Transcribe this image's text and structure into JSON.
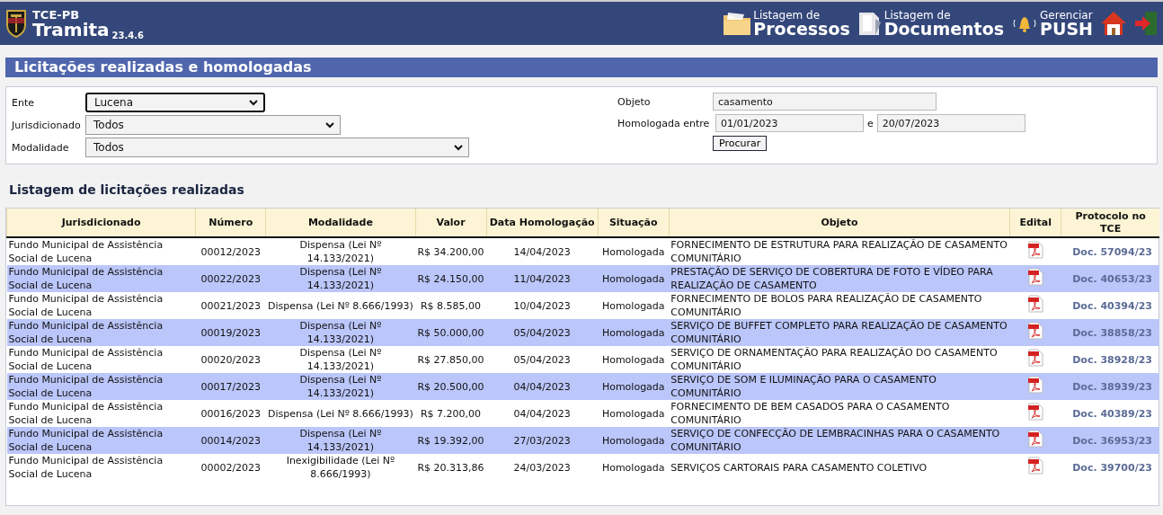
{
  "header": {
    "org": "TCE-PB",
    "app": "Tramita",
    "version": "23.4.6",
    "nav": [
      {
        "kind": "folder",
        "small": "Listagem de",
        "big": "Processos"
      },
      {
        "kind": "document",
        "small": "Listagem de",
        "big": "Documentos"
      },
      {
        "kind": "bell",
        "small": "Gerenciar",
        "big": "PUSH"
      }
    ],
    "actions": [
      {
        "kind": "home"
      },
      {
        "kind": "exit"
      }
    ]
  },
  "page_title": "Licitações realizadas e homologadas",
  "filters": {
    "selects": [
      {
        "label": "Ente",
        "value": "Lucena",
        "focused": true
      },
      {
        "label": "Jurisdicionado",
        "value": "Todos",
        "focused": false
      },
      {
        "label": "Modalidade",
        "value": "Todos",
        "focused": false
      }
    ],
    "objeto": {
      "label": "Objeto",
      "value": "casamento"
    },
    "homologada": {
      "label": "Homologada entre",
      "from": "01/01/2023",
      "joiner": "e",
      "to": "20/07/2023"
    },
    "search_button": "Procurar"
  },
  "section_title": "Listagem de licitações realizadas",
  "table": {
    "columns": [
      "Jurisdicionado",
      "Número",
      "Modalidade",
      "Valor",
      "Data Homologação",
      "Situação",
      "Objeto",
      "Edital",
      "Protocolo no TCE"
    ],
    "rows": [
      {
        "jurisdicionado": "Fundo Municipal de Assistência Social de Lucena",
        "numero": "00012/2023",
        "modalidade": "Dispensa (Lei Nº 14.133/2021)",
        "valor": "R$ 34.200,00",
        "data": "14/04/2023",
        "situacao": "Homologada",
        "objeto": "FORNECIMENTO DE ESTRUTURA PARA REALIZAÇÃO DE CASAMENTO COMUNITÁRIO",
        "protocolo": "Doc. 57094/23"
      },
      {
        "jurisdicionado": "Fundo Municipal de Assistência Social de Lucena",
        "numero": "00022/2023",
        "modalidade": "Dispensa (Lei Nº 14.133/2021)",
        "valor": "R$ 24.150,00",
        "data": "11/04/2023",
        "situacao": "Homologada",
        "objeto": "PRESTAÇÃO DE SERVIÇO DE COBERTURA DE FOTO E VÍDEO PARA REALIZAÇÃO DE CASAMENTO",
        "protocolo": "Doc. 40653/23"
      },
      {
        "jurisdicionado": "Fundo Municipal de Assistência Social de Lucena",
        "numero": "00021/2023",
        "modalidade": "Dispensa (Lei Nº 8.666/1993)",
        "valor": "R$ 8.585,00",
        "data": "10/04/2023",
        "situacao": "Homologada",
        "objeto": "FORNECIMENTO DE BOLOS PARA REALIZAÇÃO DE CASAMENTO COMUNITÁRIO",
        "protocolo": "Doc. 40394/23"
      },
      {
        "jurisdicionado": "Fundo Municipal de Assistência Social de Lucena",
        "numero": "00019/2023",
        "modalidade": "Dispensa (Lei Nº 14.133/2021)",
        "valor": "R$ 50.000,00",
        "data": "05/04/2023",
        "situacao": "Homologada",
        "objeto": "SERVIÇO DE BUFFET COMPLETO PARA REALIZAÇÃO DE CASAMENTO COMUNITÁRIO",
        "protocolo": "Doc. 38858/23"
      },
      {
        "jurisdicionado": "Fundo Municipal de Assistência Social de Lucena",
        "numero": "00020/2023",
        "modalidade": "Dispensa (Lei Nº 14.133/2021)",
        "valor": "R$ 27.850,00",
        "data": "05/04/2023",
        "situacao": "Homologada",
        "objeto": "SERVIÇO DE ORNAMENTAÇÃO PARA REALIZAÇÃO DO CASAMENTO COMUNITÁRIO",
        "protocolo": "Doc. 38928/23"
      },
      {
        "jurisdicionado": "Fundo Municipal de Assistência Social de Lucena",
        "numero": "00017/2023",
        "modalidade": "Dispensa (Lei Nº 14.133/2021)",
        "valor": "R$ 20.500,00",
        "data": "04/04/2023",
        "situacao": "Homologada",
        "objeto": "SERVIÇO DE SOM E ILUMINAÇÃO PARA O CASAMENTO COMUNITÁRIO",
        "protocolo": "Doc. 38939/23"
      },
      {
        "jurisdicionado": "Fundo Municipal de Assistência Social de Lucena",
        "numero": "00016/2023",
        "modalidade": "Dispensa (Lei Nº 8.666/1993)",
        "valor": "R$ 7.200,00",
        "data": "04/04/2023",
        "situacao": "Homologada",
        "objeto": "FORNECIMENTO DE BEM CASADOS PARA O CASAMENTO COMUNITÁRIO",
        "protocolo": "Doc. 40389/23"
      },
      {
        "jurisdicionado": "Fundo Municipal de Assistência Social de Lucena",
        "numero": "00014/2023",
        "modalidade": "Dispensa (Lei Nº 14.133/2021)",
        "valor": "R$ 19.392,00",
        "data": "27/03/2023",
        "situacao": "Homologada",
        "objeto": "SERVIÇO DE CONFECÇÃO DE LEMBRACINHAS PARA O CASAMENTO COMUNITÁRIO",
        "protocolo": "Doc. 36953/23"
      },
      {
        "jurisdicionado": "Fundo Municipal de Assistência Social de Lucena",
        "numero": "00002/2023",
        "modalidade": "Inexigibilidade (Lei Nº 8.666/1993)",
        "valor": "R$ 20.313,86",
        "data": "24/03/2023",
        "situacao": "Homologada",
        "objeto": "SERVIÇOS CARTORAIS PARA CASAMENTO COLETIVO",
        "protocolo": "Doc. 39700/23"
      }
    ]
  }
}
